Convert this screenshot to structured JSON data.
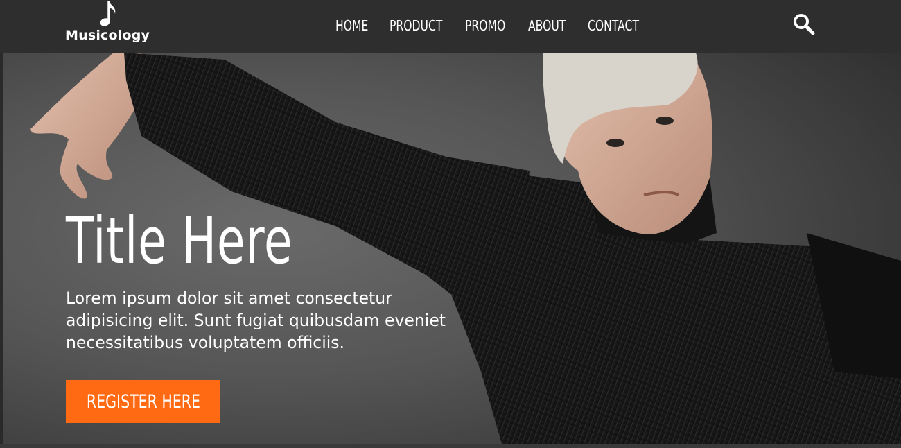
{
  "brand": {
    "name": "Musicology",
    "icon": "music-note-icon"
  },
  "nav": {
    "items": [
      {
        "label": "HOME"
      },
      {
        "label": "PRODUCT"
      },
      {
        "label": "PROMO"
      },
      {
        "label": "ABOUT"
      },
      {
        "label": "CONTACT"
      }
    ],
    "search_icon": "search-icon"
  },
  "hero": {
    "title": "Title Here",
    "text": "Lorem ipsum dolor sit amet consectetur adipisicing elit. Sunt fugiat quibusdam eveniet necessitatibus voluptatem officiis.",
    "button_label": "REGISTER HERE"
  },
  "colors": {
    "navbar_bg": "#2e2e2e",
    "accent": "#ff6a13",
    "text": "#ffffff"
  }
}
